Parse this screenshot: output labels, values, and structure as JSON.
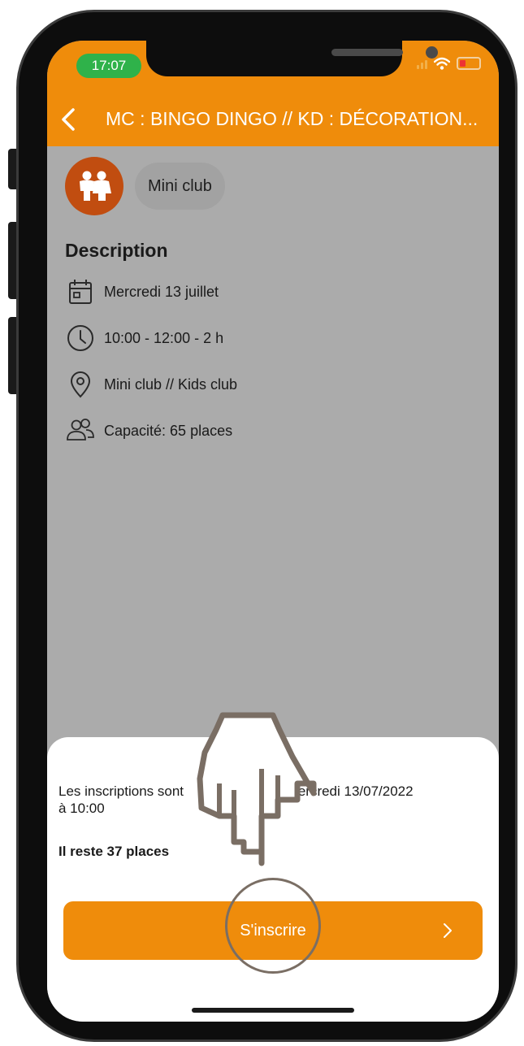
{
  "status": {
    "time": "17:07"
  },
  "header": {
    "title": "MC : BINGO DINGO // KD : DÉCORATION..."
  },
  "category": {
    "label": "Mini club"
  },
  "description": {
    "title": "Description",
    "date": "Mercredi 13 juillet",
    "time": "10:00 - 12:00 - 2 h",
    "location": "Mini club // Kids club",
    "capacity": "Capacité: 65 places"
  },
  "sheet": {
    "info_part1": "Les inscriptions sont",
    "info_part2": "au mercredi 13/07/2022",
    "info_part3": "à 10:00",
    "remaining": "Il reste 37 places",
    "cta_label": "S'inscrire"
  },
  "colors": {
    "accent": "#ef8c0b",
    "category_icon": "#c14d10",
    "status_time": "#2fb24a"
  },
  "icons": [
    "back-chevron-icon",
    "children-icon",
    "calendar-icon",
    "clock-icon",
    "location-pin-icon",
    "people-icon",
    "chevron-right-icon",
    "pointing-hand-icon"
  ]
}
